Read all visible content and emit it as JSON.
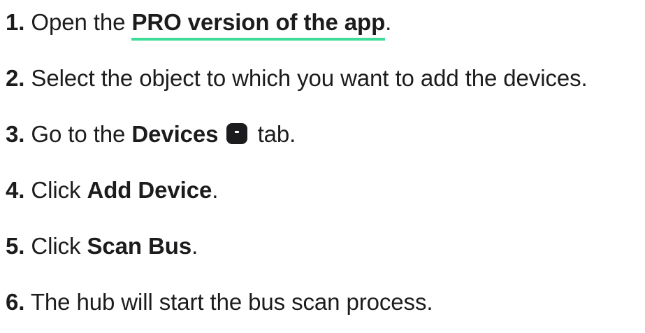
{
  "steps": [
    {
      "number": "1.",
      "text_before": "Open the ",
      "link": "PRO version of the app",
      "text_after": "."
    },
    {
      "number": "2.",
      "text": "Select the object to which you want to add the devices."
    },
    {
      "number": "3.",
      "text_before": "Go to the ",
      "bold": "Devices",
      "icon": "devices-tab-icon",
      "text_after": " tab."
    },
    {
      "number": "4.",
      "text_before": "Click ",
      "bold": "Add Device",
      "text_after": "."
    },
    {
      "number": "5.",
      "text_before": "Click ",
      "bold": "Scan Bus",
      "text_after": "."
    },
    {
      "number": "6.",
      "text": "The hub will start the bus scan process."
    }
  ],
  "colors": {
    "text": "#1c1c1e",
    "link_underline": "#3ddc97",
    "background": "#ffffff"
  }
}
